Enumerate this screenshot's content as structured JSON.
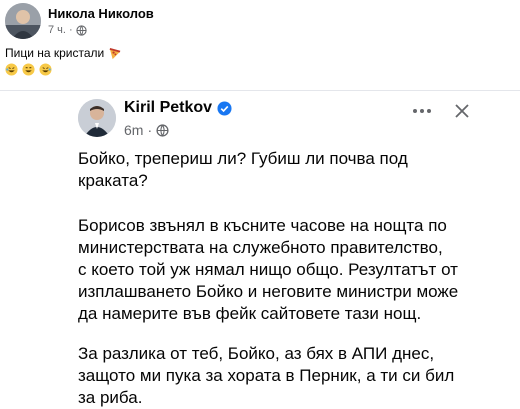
{
  "outer_post": {
    "author": "Никола Николов",
    "time": "7 ч.",
    "caption": "Пици на кристали",
    "caption_emoji": "pizza-emoji",
    "reactions": [
      "rofl-emoji",
      "grin-emoji",
      "rofl-emoji"
    ]
  },
  "embedded_post": {
    "author": "Kiril Petkov",
    "time": "6m",
    "paragraphs": [
      [
        "Бойко, трепериш ли? Губиш ли почва под",
        "краката?"
      ],
      [
        "Борисов звънял в късните часове на нощта по",
        "министерствата на служебното правителство,",
        "с което той уж нямал нищо общо. Резултатът от",
        "изплашването Бойко и неговите министри може",
        "да намерите във фейк сайтовете тази нощ."
      ],
      [
        "За разлика от теб, Бойко, аз бях в АПИ днес,",
        "защото ми пука за хората в Перник, а ти си бил",
        "за риба."
      ]
    ]
  },
  "colors": {
    "secondary_text": "#65676b",
    "verified_blue": "#1877f2"
  }
}
